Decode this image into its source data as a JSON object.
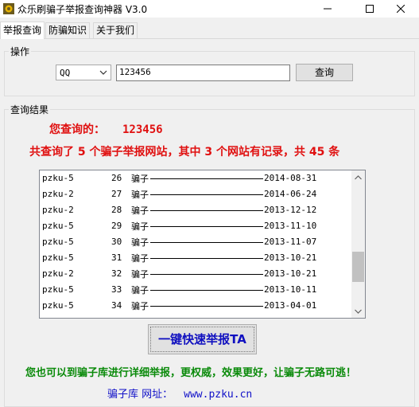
{
  "window": {
    "title": "众乐刷骗子举报查询神器 V3.0",
    "minimize_glyph": "—",
    "maximize_glyph": "☐",
    "close_glyph": "✕"
  },
  "tabs": [
    "举报查询",
    "防骗知识",
    "关于我们"
  ],
  "operation": {
    "legend": "操作",
    "select_value": "QQ",
    "input_value": "123456",
    "query_label": "查询"
  },
  "results": {
    "legend": "查询结果",
    "you_queried_label": "您查询的：",
    "you_queried_value": "123456",
    "summary": "共查询了 5 个骗子举报网站，其中 3 个网站有记录，共 45 条",
    "rows": [
      {
        "site": "pzku-5",
        "no": "26",
        "type": "骗子",
        "date": "2014-08-31"
      },
      {
        "site": "pzku-2",
        "no": "27",
        "type": "骗子",
        "date": "2014-06-24"
      },
      {
        "site": "pzku-2",
        "no": "28",
        "type": "骗子",
        "date": "2013-12-12"
      },
      {
        "site": "pzku-5",
        "no": "29",
        "type": "骗子",
        "date": "2013-11-10"
      },
      {
        "site": "pzku-5",
        "no": "30",
        "type": "骗子",
        "date": "2013-11-07"
      },
      {
        "site": "pzku-5",
        "no": "31",
        "type": "骗子",
        "date": "2013-10-21"
      },
      {
        "site": "pzku-2",
        "no": "32",
        "type": "骗子",
        "date": "2013-10-21"
      },
      {
        "site": "pzku-5",
        "no": "33",
        "type": "骗子",
        "date": "2013-10-11"
      },
      {
        "site": "pzku-5",
        "no": "34",
        "type": "骗子",
        "date": "2013-04-01"
      }
    ],
    "scroll_position_fraction": 0.75
  },
  "report_button": "一键快速举报TA",
  "promo": "您也可以到骗子库进行详细举报，更权威，效果更好，让骗子无路可逃！",
  "site": {
    "label": "骗子库 网址：",
    "url": "www.pzku.cn"
  },
  "colors": {
    "red": "#e01010",
    "green": "#0a8a0a",
    "blue": "#1010c0"
  }
}
